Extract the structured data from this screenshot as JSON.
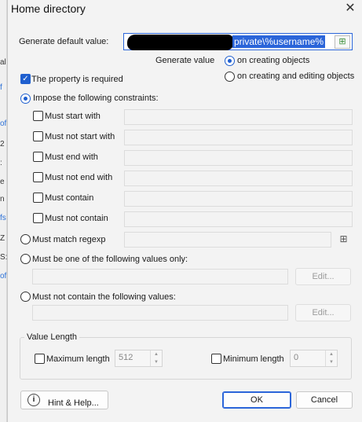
{
  "window": {
    "title": "Home directory",
    "close_symbol": "✕"
  },
  "default_value": {
    "label": "Generate default value:",
    "value_visible": "private\\%username%",
    "field_icon": "insert-variable-icon"
  },
  "generate_value": {
    "label": "Generate value",
    "options": [
      "on creating objects",
      "on creating and editing objects"
    ],
    "selected": "on creating objects"
  },
  "required": {
    "label": "The property is required",
    "checked": true
  },
  "constraints": {
    "impose_label": "Impose the following constraints:",
    "impose_selected": true,
    "items": [
      {
        "label": "Must start with",
        "checked": false,
        "value": ""
      },
      {
        "label": "Must not start with",
        "checked": false,
        "value": ""
      },
      {
        "label": "Must end with",
        "checked": false,
        "value": ""
      },
      {
        "label": "Must not end with",
        "checked": false,
        "value": ""
      },
      {
        "label": "Must contain",
        "checked": false,
        "value": ""
      },
      {
        "label": "Must not contain",
        "checked": false,
        "value": ""
      }
    ],
    "regexp_label": "Must match regexp",
    "one_of_label": "Must be one of the following values only:",
    "not_contain_values_label": "Must not contain the following values:",
    "edit_label": "Edit..."
  },
  "value_length": {
    "group_label": "Value Length",
    "max_label": "Maximum length",
    "max_value": "512",
    "min_label": "Minimum length",
    "min_value": "0"
  },
  "footer": {
    "hint_label": "Hint & Help...",
    "ok_label": "OK",
    "cancel_label": "Cancel"
  },
  "background_fragments": [
    "al",
    "f",
    "of",
    "2",
    ":",
    "e",
    "n",
    "fs",
    "Z",
    "S:",
    "of"
  ]
}
